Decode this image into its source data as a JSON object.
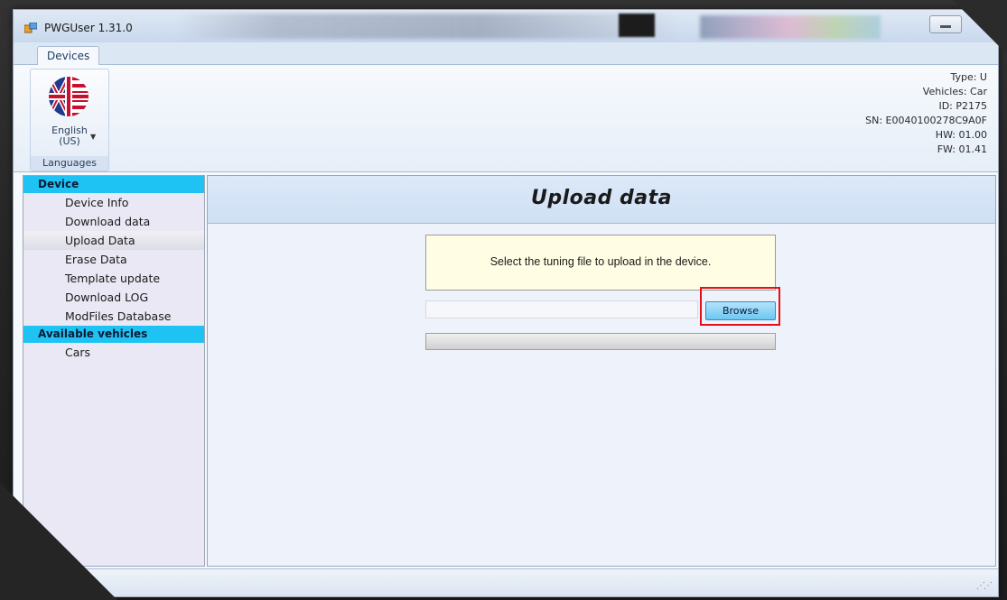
{
  "window": {
    "title": "PWGUser 1.31.0"
  },
  "ribbon": {
    "tab": "Devices",
    "language": {
      "label_line1": "English",
      "label_line2": "(US)",
      "group_caption": "Languages"
    },
    "device_info": [
      "Type: U",
      "Vehicles: Car",
      "ID: P2175",
      "SN: E0040100278C9A0F",
      "HW: 01.00",
      "FW: 01.41"
    ]
  },
  "sidebar": {
    "sections": [
      {
        "header": "Device",
        "items": [
          "Device Info",
          "Download data",
          "Upload Data",
          "Erase Data",
          "Template update",
          "Download LOG",
          "ModFiles Database"
        ]
      },
      {
        "header": "Available vehicles",
        "items": [
          "Cars"
        ]
      }
    ],
    "active_item": "Upload Data"
  },
  "main": {
    "title": "Upload data",
    "message": "Select the tuning file to upload in the device.",
    "file_path": "",
    "browse_label": "Browse",
    "progress": 0
  },
  "colors": {
    "sidebar_header": "#1ec3f3",
    "highlight": "#e2101a",
    "message_bg": "#fffde3"
  }
}
